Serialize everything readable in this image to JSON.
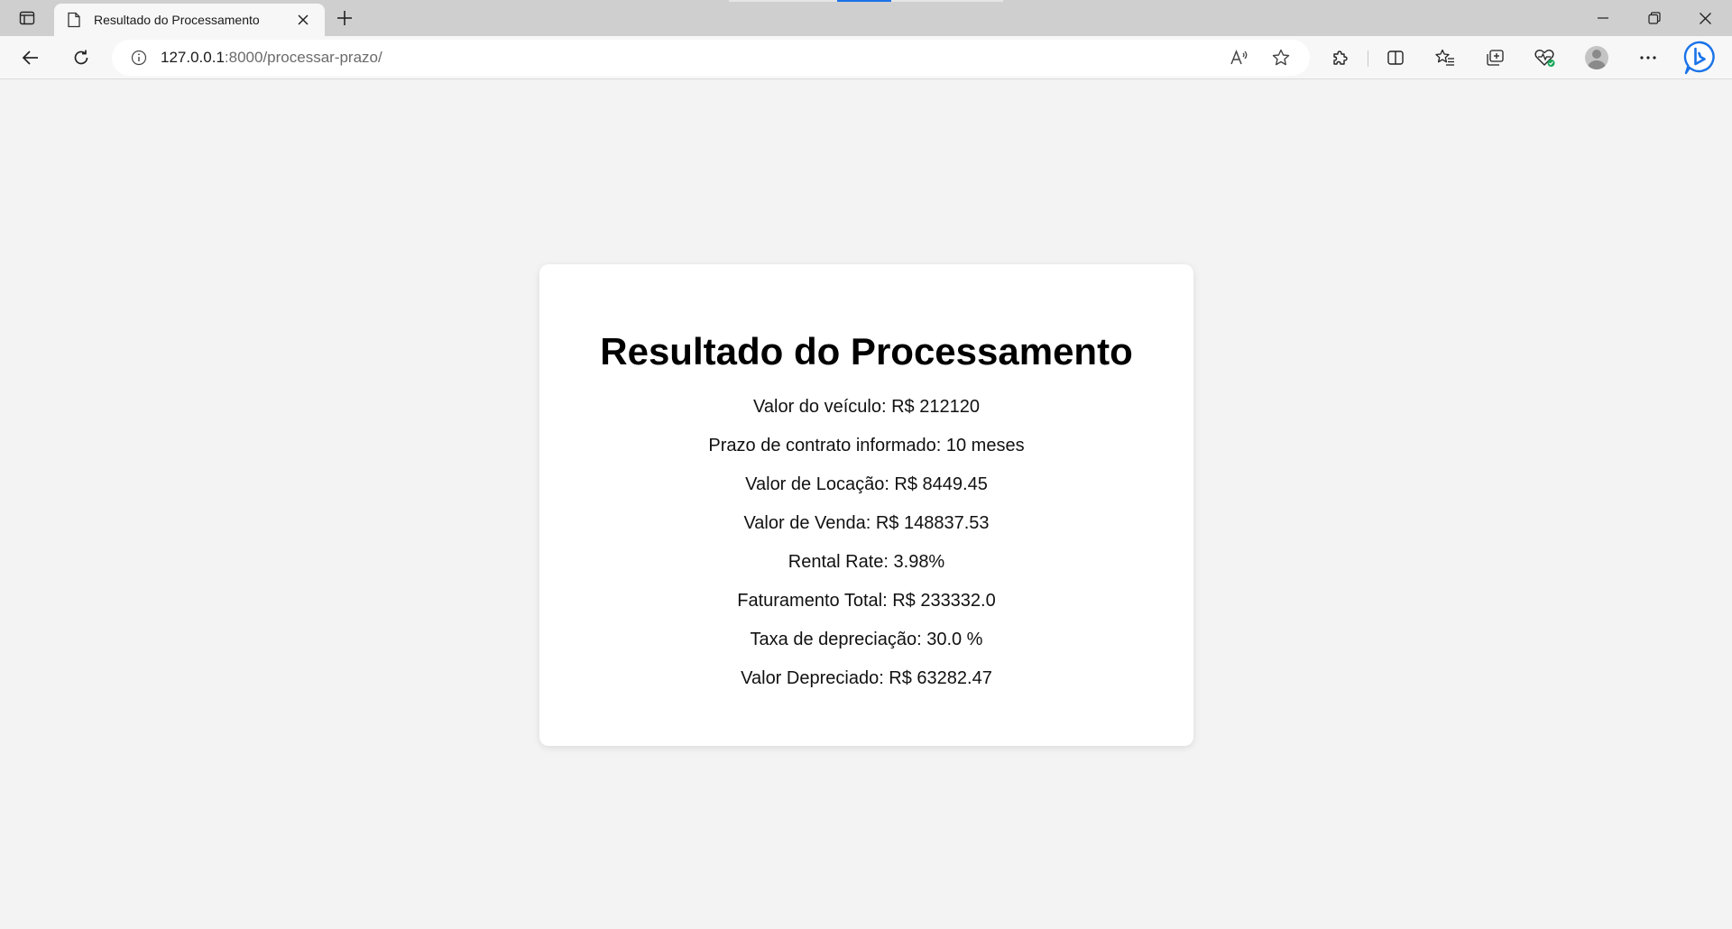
{
  "browser": {
    "tab": {
      "title": "Resultado do Processamento"
    },
    "address_bar": {
      "host": "127.0.0.1",
      "rest": ":8000/processar-prazo/"
    },
    "accent_color": "#1a73e8"
  },
  "page": {
    "heading": "Resultado do Processamento",
    "results": [
      "Valor do veículo: R$ 212120",
      "Prazo de contrato informado: 10 meses",
      "Valor de Locação: R$ 8449.45",
      "Valor de Venda: R$ 148837.53",
      "Rental Rate: 3.98%",
      "Faturamento Total: R$ 233332.0",
      "Taxa de depreciação: 30.0 %",
      "Valor Depreciado: R$ 63282.47"
    ]
  }
}
